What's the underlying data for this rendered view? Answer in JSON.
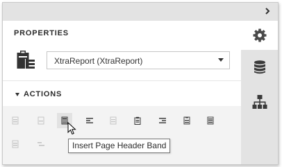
{
  "header": {
    "collapse_icon": "chevron-right-icon"
  },
  "properties": {
    "title": "PROPERTIES",
    "report_selector": {
      "value": "XtraReport (XtraReport)"
    }
  },
  "actions": {
    "title": "ACTIONS",
    "tooltip": "Insert Page Header Band"
  },
  "side_tabs": [
    "gear-icon",
    "database-icon",
    "hierarchy-icon"
  ],
  "colors": {
    "panel_gray": "#e3e3e3",
    "actions_bg": "#f3f3f3",
    "icon_dark": "#333333",
    "icon_disabled": "#c4c4c4"
  }
}
